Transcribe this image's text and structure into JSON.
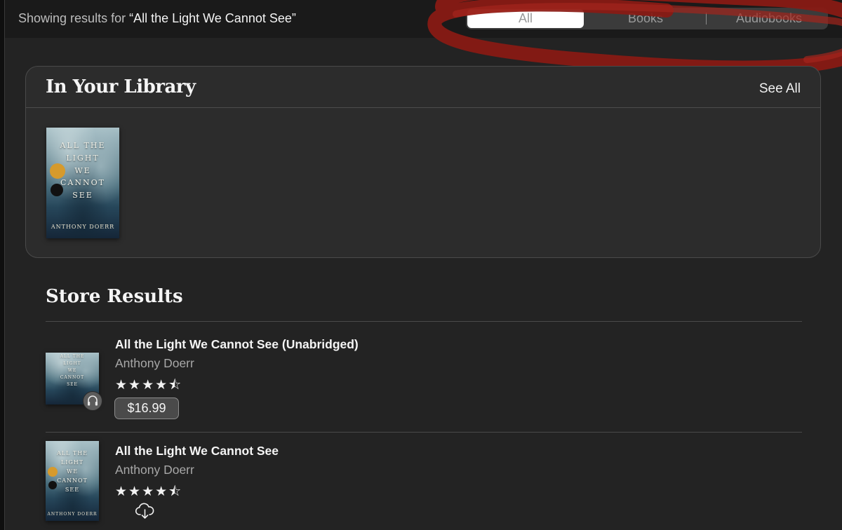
{
  "header": {
    "showing_prefix": "Showing results for ",
    "query": "“All the Light We Cannot See”"
  },
  "filter_tabs": [
    {
      "label": "All",
      "selected": true
    },
    {
      "label": "Books",
      "selected": false
    },
    {
      "label": "Audiobooks",
      "selected": false
    }
  ],
  "library": {
    "title": "In Your Library",
    "see_all": "See All",
    "cover": {
      "lines": [
        "ALL THE",
        "LIGHT",
        "WE",
        "CANNOT",
        "SEE"
      ],
      "author": "ANTHONY DOERR"
    }
  },
  "store": {
    "title": "Store Results",
    "results": [
      {
        "title": "All the Light We Cannot See (Unabridged)",
        "author": "Anthony Doerr",
        "rating": 4.5,
        "stars_display": "★★★★⯪",
        "price": "$16.99",
        "format_icon": "headphones-icon"
      },
      {
        "title": "All the Light We Cannot See",
        "author": "Anthony Doerr",
        "rating": 4.5,
        "stars_display": "★★★★⯪",
        "action_icon": "cloud-download-icon"
      }
    ]
  },
  "colors": {
    "background": "#232323",
    "topbar": "#1a1a1a",
    "panel": "#2c2c2c",
    "selected_segment": "#ffffff",
    "scribble": "#8b1a14"
  }
}
